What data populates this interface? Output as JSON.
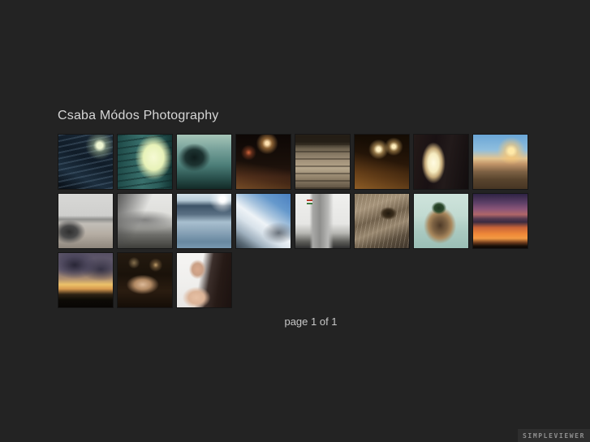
{
  "page": {
    "title": "Csaba Módos Photography",
    "paging_text": "page 1 of 1",
    "badge_text": "SIMPLEVIEWER",
    "colors": {
      "background": "#232323",
      "title_text": "#d6d6d6",
      "paging_text": "#c8c8c8",
      "badge_bg": "#2e2e2e",
      "badge_text": "#8f8f8f"
    }
  },
  "gallery": {
    "rows": 3,
    "columns": 8,
    "thumbnail_count": 19,
    "thumbnails": [
      {
        "name": "night-stairs",
        "bg": "radial-gradient(circle at 76% 20%, #eef6d2 0%, #eef6d2 5%, rgba(190,215,170,0.45) 11%, rgba(90,120,130,0) 24%), repeating-linear-gradient(168deg, rgba(130,160,185,0.22) 0px, rgba(130,160,185,0.22) 2px, rgba(0,0,0,0) 2px, rgba(0,0,0,0) 7px), linear-gradient(205deg, #1b2a38 0%, #101c28 45%, #1c2e3e 72%, #070c12 100%)"
      },
      {
        "name": "barred-window",
        "bg": "radial-gradient(ellipse 34% 42% at 66% 42%, #f6fad4 0%, #e7f2b8 55%, rgba(120,160,120,0) 100%), repeating-linear-gradient(172deg, rgba(15,40,40,0.5) 0px, rgba(15,40,40,0.5) 2px, rgba(0,0,0,0) 2px, rgba(0,0,0,0) 8px), linear-gradient(90deg, #1e4a48 0%, #39706c 45%, #2b5d5a 75%, #123534 100%)"
      },
      {
        "name": "teal-tunnel",
        "bg": "radial-gradient(ellipse 30% 26% at 32% 42%, #0f1d1c 0%, #1d3331 55%, rgba(60,100,95,0) 100%), linear-gradient(180deg, #a7c6b9 0%, #76a099 28%, #4e807a 55%, #2c5450 78%, #132a27 100%)"
      },
      {
        "name": "night-street",
        "bg": "radial-gradient(circle at 57% 16%, #ffe2b0 0%, #ffe2b0 3%, rgba(240,170,90,0.55) 9%, rgba(0,0,0,0) 20%), radial-gradient(circle at 23% 33%, rgba(255,120,70,0.8) 0%, rgba(200,90,50,0.4) 6%, rgba(0,0,0,0) 14%), linear-gradient(10deg, rgba(215,140,70,0.5) 0%, rgba(150,90,45,0.35) 22%, rgba(0,0,0,0) 45%), linear-gradient(180deg, #0d0705 0%, #1a100a 55%, #2a1710 78%, #120a06 100%)"
      },
      {
        "name": "stone-steps",
        "bg": "repeating-linear-gradient(0deg, rgba(35,28,20,0.4) 0px, rgba(35,28,20,0.4) 2px, rgba(0,0,0,0) 2px, rgba(0,0,0,0) 9px), linear-gradient(180deg, #241e16 0%, #241e16 14%, #6e6350 26%, #a2927a 48%, #b5a68c 62%, #8f8069 80%, #5c5040 100%)"
      },
      {
        "name": "lamplit-path",
        "bg": "radial-gradient(circle at 44% 27%, #fff0c2 0%, #fff0c2 4%, rgba(255,210,130,0.5) 10%, rgba(0,0,0,0) 20%), radial-gradient(circle at 72% 22%, #ffeebc 0%, #ffeebc 3%, rgba(255,205,120,0.45) 8%, rgba(0,0,0,0) 16%), linear-gradient(15deg, rgba(205,135,55,0.65) 0%, rgba(160,100,40,0.45) 28%, rgba(60,35,15,0.2) 55%, rgba(0,0,0,0) 75%), linear-gradient(180deg, #140c04 0%, #201206 45%, #2a1808 70%, #170d05 100%)"
      },
      {
        "name": "bright-archway",
        "bg": "radial-gradient(ellipse 22% 38% at 36% 52%, #fffbe2 0%, #f6ecc0 45%, #c3a878 70%, rgba(80,60,45,0) 100%), linear-gradient(100deg, #241a18 0%, #191113 35%, #221a1a 60%, #120d0e 100%)"
      },
      {
        "name": "bridge-sunset",
        "bg": "radial-gradient(circle at 70% 30%, #ffe9a8 0%, #ffe9a8 5%, rgba(255,200,110,0.6) 12%, rgba(0,0,0,0) 26%), linear-gradient(180deg, #6aa6d6 0%, #8fbede 28%, #e3c490 44%, #c09468 54%, #7e6244 68%, #5a452e 82%, #463523 100%)"
      },
      {
        "name": "winter-bench",
        "bg": "radial-gradient(ellipse 30% 22% at 20% 70%, #2f2f2f 0%, #4a4a4a 50%, rgba(120,120,120,0) 100%), linear-gradient(180deg, #d8d8d6 0%, #cfcfcd 40%, #8f8f8d 47%, #c2beb8 55%, #b4aca2 75%, #8e867c 100%)"
      },
      {
        "name": "winter-pier",
        "bg": "linear-gradient(115deg, rgba(40,40,40,0.75) 0%, rgba(70,70,70,0.55) 18%, rgba(0,0,0,0) 45%), radial-gradient(ellipse 60% 18% at 50% 48%, rgba(110,110,110,0.8) 0%, rgba(0,0,0,0) 100%), linear-gradient(180deg, #e8e8e6 0%, #dededa 42%, #b8b8b4 55%, #6e6e6a 75%, #3e3e3a 100%)"
      },
      {
        "name": "winter-trees",
        "bg": "radial-gradient(circle at 84% 10%, #ffffff 0%, #ffffff 4%, rgba(255,255,255,0.5) 10%, rgba(0,0,0,0) 20%), linear-gradient(180deg, #d4e2ea 0%, #b8ccd8 12%, #3e5468 22%, #5a7084 38%, #a8bfcf 52%, #8aa4b8 70%, #6888a0 88%, #7898b0 100%)"
      },
      {
        "name": "snowy-mountains",
        "bg": "radial-gradient(ellipse 30% 20% at 78% 72%, rgba(50,60,72,0.7) 0%, rgba(0,0,0,0) 100%), linear-gradient(215deg, #4a7fc0 0%, #6699cc 22%, #a8c4de 38%, #eef3f7 52%, #d8e2ea 64%, #9fb0be 78%, #5a6a76 90%, #384450 100%)"
      },
      {
        "name": "castle-ruin-flag",
        "bg": "linear-gradient(180deg, #b83b2e 0%, #b83b2e 34%, #f2f2f2 34%, #f2f2f2 67%, #3e7a3e 67%, #3e7a3e 100%) 24% 12% / 7px 6px no-repeat, linear-gradient(90deg, rgba(0,0,0,0) 26%, #a8a8a6 32%, #8e8e8c 45%, #b8b8b6 60%, rgba(0,0,0,0) 70%), linear-gradient(180deg, #f0f0ee 0%, #e6e6e4 55%, #b8b8b4 72%, #5e5e5a 88%, #303030 100%)"
      },
      {
        "name": "duck-takeoff",
        "bg": "radial-gradient(ellipse 16% 12% at 62% 36%, #20180e 0%, #3a2d1c 60%, rgba(0,0,0,0) 100%), repeating-linear-gradient(100deg, rgba(255,240,220,0.18) 0px, rgba(255,240,220,0.18) 1px, rgba(0,0,0,0) 1px, rgba(0,0,0,0) 5px), linear-gradient(160deg, #8a7960 0%, #a5937a 25%, #71614c 45%, #998870 62%, #5c4f3e 80%, #3e342a 100%)"
      },
      {
        "name": "mallard-wings",
        "bg": "radial-gradient(ellipse 14% 12% at 46% 26%, #1e3520 0%, #2c4a2c 60%, rgba(0,0,0,0) 100%), radial-gradient(ellipse 30% 34% at 48% 58%, #4e3a28 0%, #7e6344 45%, #a8875c 70%, rgba(0,0,0,0) 100%), linear-gradient(180deg, #cfe4dc 0%, #c2dbd2 40%, #a9c9c0 70%, #9bbfb6 100%)"
      },
      {
        "name": "sunset-clouds",
        "bg": "linear-gradient(180deg, #2e2344 0%, #5c3f66 16%, #8a5578 28%, #b06668 38%, #553a50 46%, #3a2a40 52%, #c76338 62%, #ef8838 74%, #f29a44 82%, #6b3a1c 90%, #160e08 96%, #0c0806 100%)"
      },
      {
        "name": "sunset-trees",
        "bg": "radial-gradient(ellipse 40% 26% at 30% 22%, rgba(30,28,44,0.85) 0%, rgba(60,56,80,0.5) 60%, rgba(0,0,0,0) 100%), radial-gradient(ellipse 36% 22% at 78% 30%, rgba(40,38,56,0.8) 0%, rgba(0,0,0,0) 100%), linear-gradient(180deg, #565064 0%, #6a6274 30%, #b09070 48%, #ecc26a 58%, #d89a4e 66%, #2e2214 76%, #0d0a06 86%, #080604 100%)"
      },
      {
        "name": "night-model",
        "bg": "radial-gradient(ellipse 30% 18% at 46% 58%, #dcb998 0%, #b28a64 50%, rgba(0,0,0,0) 100%), radial-gradient(circle at 70% 22%, rgba(230,190,130,0.8) 0%, rgba(190,150,95,0.4) 5%, rgba(0,0,0,0) 12%), radial-gradient(circle at 30% 18%, rgba(200,170,120,0.6) 0%, rgba(0,0,0,0) 10%), linear-gradient(180deg, #241a10 0%, #1a120a 40%, #2a1c10 70%, #140d07 100%)"
      },
      {
        "name": "studio-portrait",
        "bg": "radial-gradient(ellipse 16% 18% at 38% 30%, #d8a88c 0%, #caa086 60%, rgba(0,0,0,0) 100%), radial-gradient(ellipse 26% 20% at 36% 82%, #e6c0a4 0%, #dcb498 55%, rgba(0,0,0,0) 100%), linear-gradient(100deg, rgba(0,0,0,0) 42%, rgba(44,30,26,0.92) 58%, #261a16 75%, #1c1210 100%), linear-gradient(180deg, #f6f5f3 0%, #efeeec 60%, #e8e6e4 100%)"
      }
    ]
  }
}
